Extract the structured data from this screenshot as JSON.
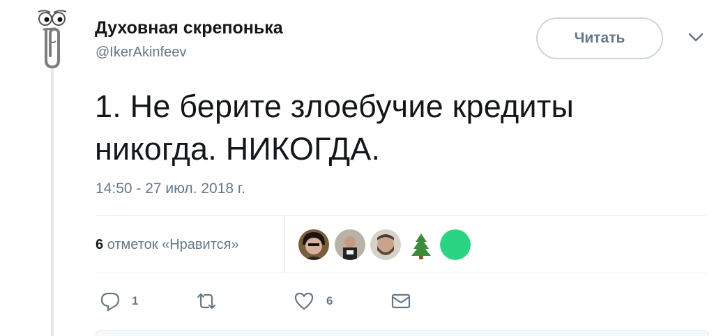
{
  "tweet": {
    "author": {
      "display_name": "Духовная скрепонька",
      "handle": "@IkerAkinfeev",
      "avatar_icon": "paperclip-avatar-icon"
    },
    "follow_label": "Читать",
    "caret_icon": "chevron-down-icon",
    "text_line1": "1. Не берите злоебучие кредиты",
    "text_line2": "никогда. НИКОГДА.",
    "timestamp": "14:50 - 27 июл. 2018 г."
  },
  "stats": {
    "likes_count": "6",
    "likes_label": "отметок «Нравится»",
    "likers": [
      {
        "name": "liker-avatar-1",
        "color": "#3a2a22"
      },
      {
        "name": "liker-avatar-2",
        "color": "#6b6158"
      },
      {
        "name": "liker-avatar-3",
        "color": "#8c7b6e"
      },
      {
        "name": "liker-avatar-4",
        "icon": "tree-icon",
        "color": "#3d8b3d"
      },
      {
        "name": "liker-avatar-5",
        "color": "#2bd483"
      }
    ]
  },
  "actions": {
    "reply_count": "1",
    "like_count": "6",
    "reply_icon": "reply-icon",
    "retweet_icon": "retweet-icon",
    "like_icon": "heart-icon",
    "dm_icon": "envelope-icon"
  },
  "colors": {
    "text": "#14171a",
    "secondary": "#657786",
    "border": "#e6ecf0",
    "thread_line": "#e1e8ed",
    "green_avatar": "#2bd483"
  }
}
